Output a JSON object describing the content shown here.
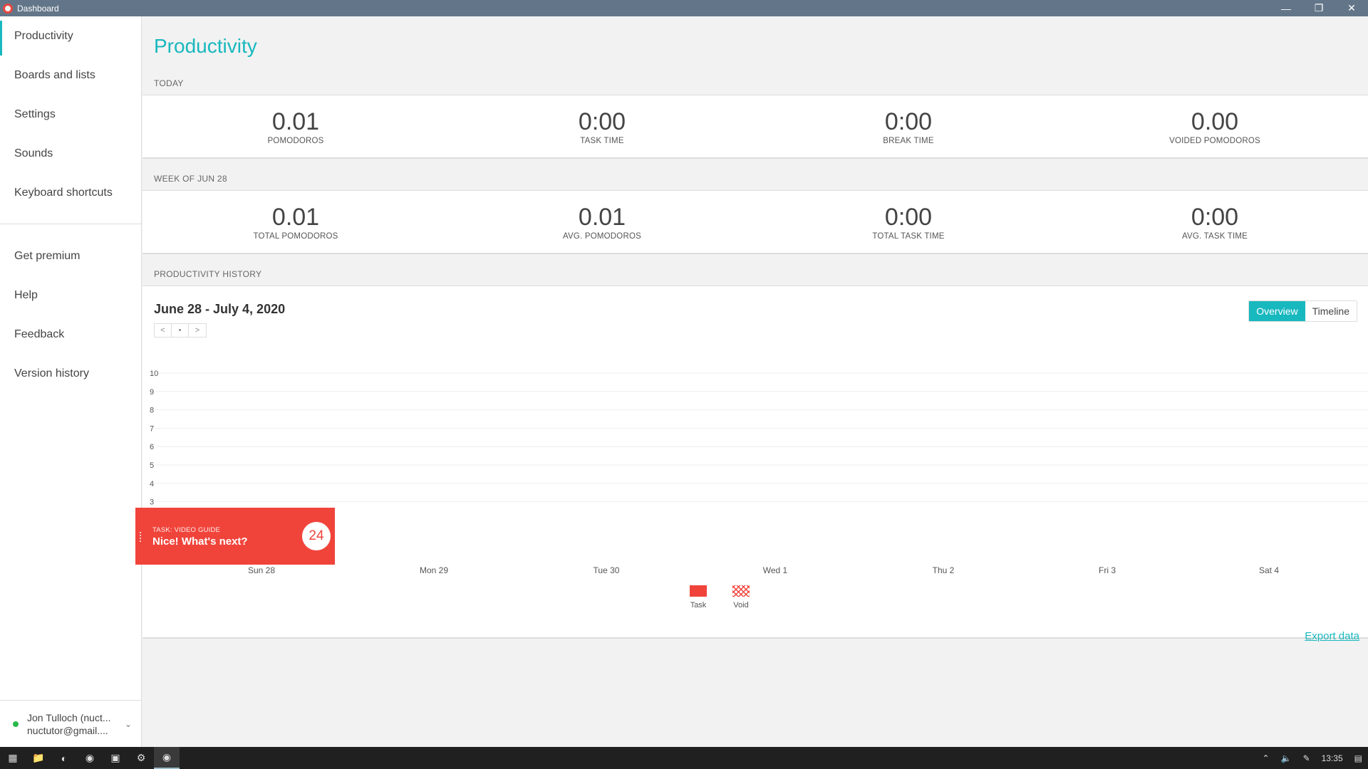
{
  "window": {
    "title": "Dashboard"
  },
  "sidebar": {
    "items": [
      {
        "label": "Productivity"
      },
      {
        "label": "Boards and lists"
      },
      {
        "label": "Settings"
      },
      {
        "label": "Sounds"
      },
      {
        "label": "Keyboard shortcuts"
      }
    ],
    "items2": [
      {
        "label": "Get premium"
      },
      {
        "label": "Help"
      },
      {
        "label": "Feedback"
      },
      {
        "label": "Version history"
      }
    ],
    "user": {
      "name": "Jon Tulloch (nuct...",
      "email": "nuctutor@gmail...."
    }
  },
  "main": {
    "title": "Productivity",
    "today_label": "TODAY",
    "today": [
      {
        "value": "0.01",
        "label": "POMODOROS"
      },
      {
        "value": "0:00",
        "label": "TASK TIME"
      },
      {
        "value": "0:00",
        "label": "BREAK TIME"
      },
      {
        "value": "0.00",
        "label": "VOIDED POMODOROS"
      }
    ],
    "week_label": "WEEK OF JUN 28",
    "week": [
      {
        "value": "0.01",
        "label": "TOTAL POMODOROS"
      },
      {
        "value": "0.01",
        "label": "AVG. POMODOROS"
      },
      {
        "value": "0:00",
        "label": "TOTAL TASK TIME"
      },
      {
        "value": "0:00",
        "label": "AVG. TASK TIME"
      }
    ],
    "history_label": "PRODUCTIVITY HISTORY",
    "range": "June 28 - July 4, 2020",
    "pager": {
      "prev": "<",
      "now": "•",
      "next": ">"
    },
    "views": {
      "overview": "Overview",
      "timeline": "Timeline"
    },
    "legend": {
      "task": "Task",
      "void": "Void"
    },
    "export": "Export data"
  },
  "chart_data": {
    "type": "bar",
    "categories": [
      "Sun 28",
      "Mon 29",
      "Tue 30",
      "Wed 1",
      "Thu 2",
      "Fri 3",
      "Sat 4"
    ],
    "series": [
      {
        "name": "Task",
        "values": [
          0.01,
          0,
          0,
          0,
          0,
          0,
          0
        ]
      },
      {
        "name": "Void",
        "values": [
          0,
          0,
          0,
          0,
          0,
          0,
          0
        ]
      }
    ],
    "yticks": [
      3,
      4,
      5,
      6,
      7,
      8,
      9,
      10
    ],
    "ylim": [
      0,
      10
    ],
    "grid": true,
    "legend_position": "bottom"
  },
  "toast": {
    "label": "TASK: VIDEO GUIDE",
    "message": "Nice! What's next?",
    "timer": "24"
  },
  "taskbar": {
    "time": "13:35"
  },
  "colors": {
    "accent": "#18b8bf",
    "task": "#f0443b",
    "titlebar": "#637689"
  }
}
